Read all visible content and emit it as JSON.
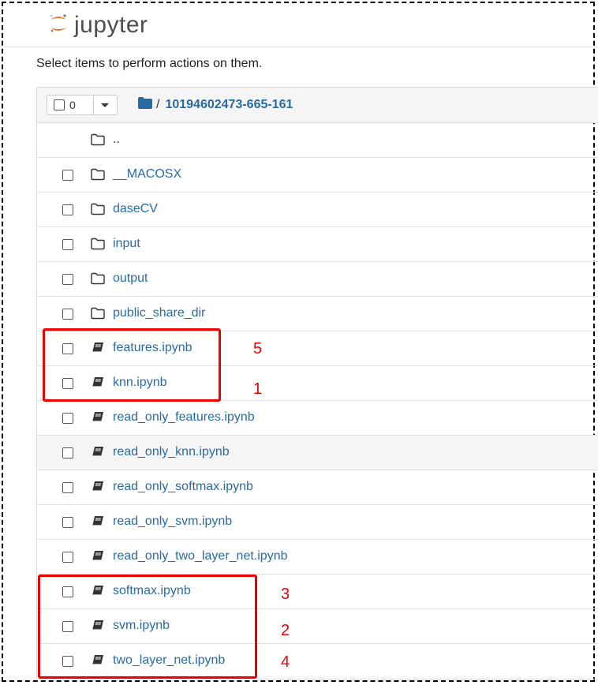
{
  "app": {
    "logo_text": "jupyter"
  },
  "instructions": "Select items to perform actions on them.",
  "header": {
    "selected_count": "0",
    "path_separator": "/",
    "current_dir": "10194602473-665-161"
  },
  "rows": [
    {
      "name": "..",
      "type": "folder",
      "checkbox": false
    },
    {
      "name": "__MACOSX",
      "type": "folder",
      "checkbox": true
    },
    {
      "name": "daseCV",
      "type": "folder",
      "checkbox": true
    },
    {
      "name": "input",
      "type": "folder",
      "checkbox": true
    },
    {
      "name": "output",
      "type": "folder",
      "checkbox": true
    },
    {
      "name": "public_share_dir",
      "type": "folder",
      "checkbox": true
    },
    {
      "name": "features.ipynb",
      "type": "notebook",
      "checkbox": true
    },
    {
      "name": "knn.ipynb",
      "type": "notebook",
      "checkbox": true
    },
    {
      "name": "read_only_features.ipynb",
      "type": "notebook",
      "checkbox": true
    },
    {
      "name": "read_only_knn.ipynb",
      "type": "notebook",
      "checkbox": true
    },
    {
      "name": "read_only_softmax.ipynb",
      "type": "notebook",
      "checkbox": true
    },
    {
      "name": "read_only_svm.ipynb",
      "type": "notebook",
      "checkbox": true
    },
    {
      "name": "read_only_two_layer_net.ipynb",
      "type": "notebook",
      "checkbox": true
    },
    {
      "name": "softmax.ipynb",
      "type": "notebook",
      "checkbox": true
    },
    {
      "name": "svm.ipynb",
      "type": "notebook",
      "checkbox": true
    },
    {
      "name": "two_layer_net.ipynb",
      "type": "notebook",
      "checkbox": true
    }
  ],
  "annotations": {
    "features": "5",
    "knn": "1",
    "softmax": "3",
    "svm": "2",
    "two_layer_net": "4"
  },
  "colors": {
    "link": "#2a6aa3",
    "annotation": "#e00000",
    "logo_orange": "#f37726"
  }
}
